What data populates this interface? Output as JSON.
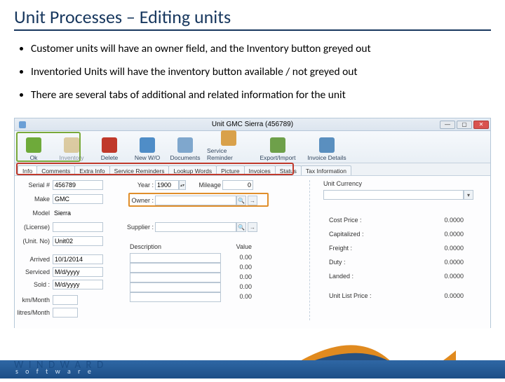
{
  "slide": {
    "title": "Unit Processes – Editing units",
    "bullets": [
      "Customer units will have an owner field, and the Inventory button greyed out",
      "Inventoried Units will have the inventory button available / not greyed out",
      "There are several tabs of additional and related information for the unit"
    ]
  },
  "window": {
    "title": "Unit GMC Sierra  (456789)",
    "buttons": {
      "min": "—",
      "max": "▢",
      "close": "✕"
    }
  },
  "toolbar": [
    {
      "label": "Ok",
      "color": "#6eaa3a",
      "interact": true,
      "wide": false
    },
    {
      "label": "Inventory",
      "color": "#caa85a",
      "interact": false,
      "wide": false,
      "greyed": true
    },
    {
      "label": "Delete",
      "color": "#c0392b",
      "interact": true,
      "wide": false
    },
    {
      "label": "New W/O",
      "color": "#4f8dc7",
      "interact": true,
      "wide": false
    },
    {
      "label": "Documents",
      "color": "#7fa7cd",
      "interact": true,
      "wide": false
    },
    {
      "label": "Service Reminder",
      "color": "#d9a14a",
      "interact": true,
      "wide": true
    },
    {
      "label": "Export/Import",
      "color": "#6ea04a",
      "interact": true,
      "wide": true
    },
    {
      "label": "Invoice Details",
      "color": "#5a8fbf",
      "interact": true,
      "wide": true
    }
  ],
  "tabs": [
    "Info",
    "Comments",
    "Extra Info",
    "Service Reminders",
    "Lookup Words",
    "Picture",
    "Invoices",
    "Status",
    "Tax Information"
  ],
  "activeTab": "Info",
  "form": {
    "left": {
      "serial_l": "Serial #",
      "serial_v": "456789",
      "make_l": "Make",
      "make_v": "GMC",
      "model_l": "Model",
      "model_v": "Sierra",
      "license_l": "(License)",
      "license_v": "",
      "unitno_l": "(Unit. No)",
      "unitno_v": "Unit02",
      "arrived_l": "Arrived",
      "arrived_v": "10/1/2014",
      "serviced_l": "Serviced",
      "serviced_v": "M/d/yyyy",
      "sold_l": "Sold :",
      "sold_v": "M/d/yyyy",
      "kmmonth_l": "km/Month",
      "kmmonth_v": "",
      "litres_l": "litres/Month",
      "litres_v": ""
    },
    "mid": {
      "year_l": "Year :",
      "year_v": "1900",
      "mileage_l": "Mileage",
      "mileage_v": "0",
      "owner_l": "Owner :",
      "owner_v": "",
      "supplier_l": "Supplier :",
      "supplier_v": "",
      "desc_l": "Description",
      "value_l": "Value",
      "rows": [
        "0.00",
        "0.00",
        "0.00",
        "0.00",
        "0.00"
      ]
    },
    "right": {
      "currency_l": "Unit Currency",
      "cost_l": "Cost Price :",
      "cost_v": "0.0000",
      "cap_l": "Capitalized :",
      "cap_v": "0.0000",
      "freight_l": "Freight :",
      "freight_v": "0.0000",
      "duty_l": "Duty :",
      "duty_v": "0.0000",
      "landed_l": "Landed :",
      "landed_v": "0.0000",
      "list_l": "Unit List Price :",
      "list_v": "0.0000"
    }
  },
  "brand": {
    "name": "W I N D W A R D",
    "sub": "s o f t w a r e"
  }
}
